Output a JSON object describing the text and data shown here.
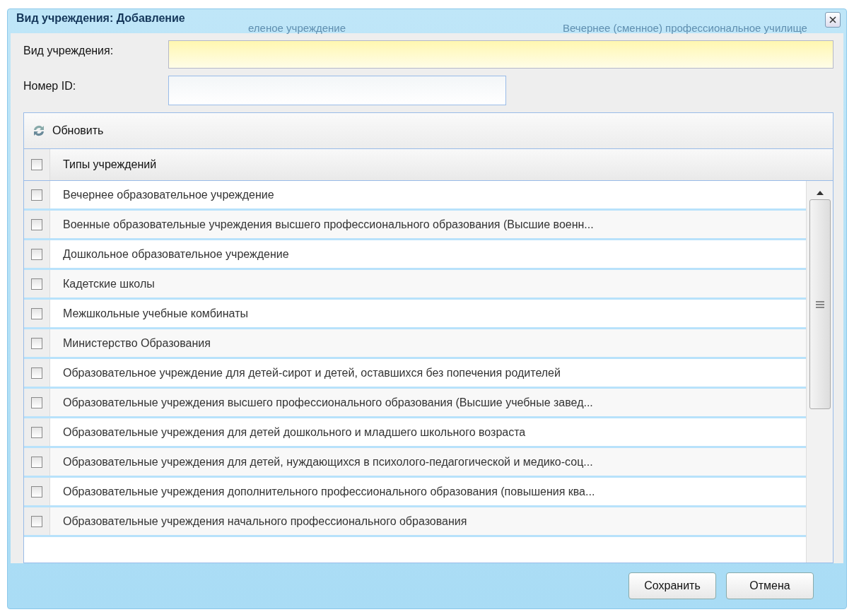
{
  "window": {
    "title": "Вид учреждения: Добавление",
    "background_texts": [
      "еленое учреждение",
      "Вечернее (сменное) профессиональное училище"
    ]
  },
  "form": [
    {
      "label": "Вид учреждения:",
      "kind": "required"
    },
    {
      "label": "Номер ID:",
      "kind": "plain"
    }
  ],
  "toolbar": {
    "refresh": "Обновить"
  },
  "table": {
    "header": {
      "label": "Типы учреждений",
      "checked": false
    },
    "rows": [
      {
        "name": "Вечернее образовательное учреждение",
        "checked": false
      },
      {
        "name": "Военные образовательные учреждения высшего профессионального образования (Высшие военн...",
        "checked": false
      },
      {
        "name": "Дошкольное образовательное учреждение",
        "checked": false
      },
      {
        "name": "Кадетские школы",
        "checked": false
      },
      {
        "name": "Межшкольные учебные комбинаты",
        "checked": false
      },
      {
        "name": "Министерство Образования",
        "checked": false
      },
      {
        "name": "Образовательное учреждение для детей-сирот и детей, оставшихся без попечения родителей",
        "checked": false
      },
      {
        "name": "Образовательные учреждения высшего профессионального образования (Высшие учебные завед...",
        "checked": false
      },
      {
        "name": "Образовательные учреждения для детей дошкольного и младшего школьного возраста",
        "checked": false
      },
      {
        "name": "Образовательные учреждения для детей, нуждающихся в психолого-педагогической и медико-соц...",
        "checked": false
      },
      {
        "name": "Образовательные учреждения дополнительного профессионального образования (повышения ква...",
        "checked": false
      },
      {
        "name": "Образовательные учреждения начального профессионального образования",
        "checked": false
      }
    ]
  },
  "buttons": [
    "Сохранить",
    "Отмена"
  ]
}
